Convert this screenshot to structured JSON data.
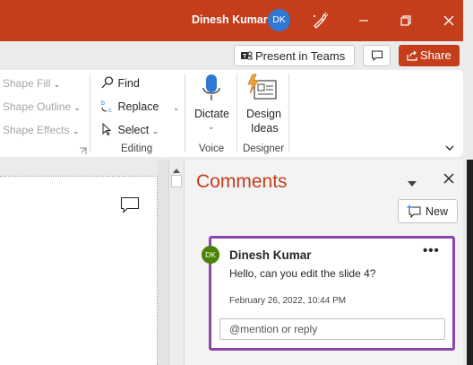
{
  "titlebar": {
    "user_name": "Dinesh Kumar",
    "avatar_initials": "DK",
    "icons": [
      "designer-pen-icon",
      "minimize-icon",
      "restore-icon",
      "close-icon"
    ]
  },
  "cmdbar": {
    "present_in_teams": "Present in Teams",
    "share": "Share"
  },
  "ribbon": {
    "shape_fill": "Shape Fill",
    "shape_outline": "Shape Outline",
    "shape_effects": "Shape Effects",
    "find": "Find",
    "replace": "Replace",
    "select": "Select",
    "editing_label": "Editing",
    "dictate": "Dictate",
    "voice_label": "Voice",
    "design_ideas_line1": "Design",
    "design_ideas_line2": "Ideas",
    "designer_label": "Designer"
  },
  "comments": {
    "title": "Comments",
    "new_button": "New",
    "card": {
      "initials": "DK",
      "author": "Dinesh Kumar",
      "text": "Hello, can you edit the slide 4?",
      "date": "February 26, 2022, 10:44 PM",
      "more": "•••",
      "reply_placeholder": "@mention or reply"
    }
  },
  "colors": {
    "brand": "#c43e1c",
    "comment_border": "#8e44ad",
    "avatar_top": "#2f78d4",
    "avatar_card": "#498205"
  }
}
